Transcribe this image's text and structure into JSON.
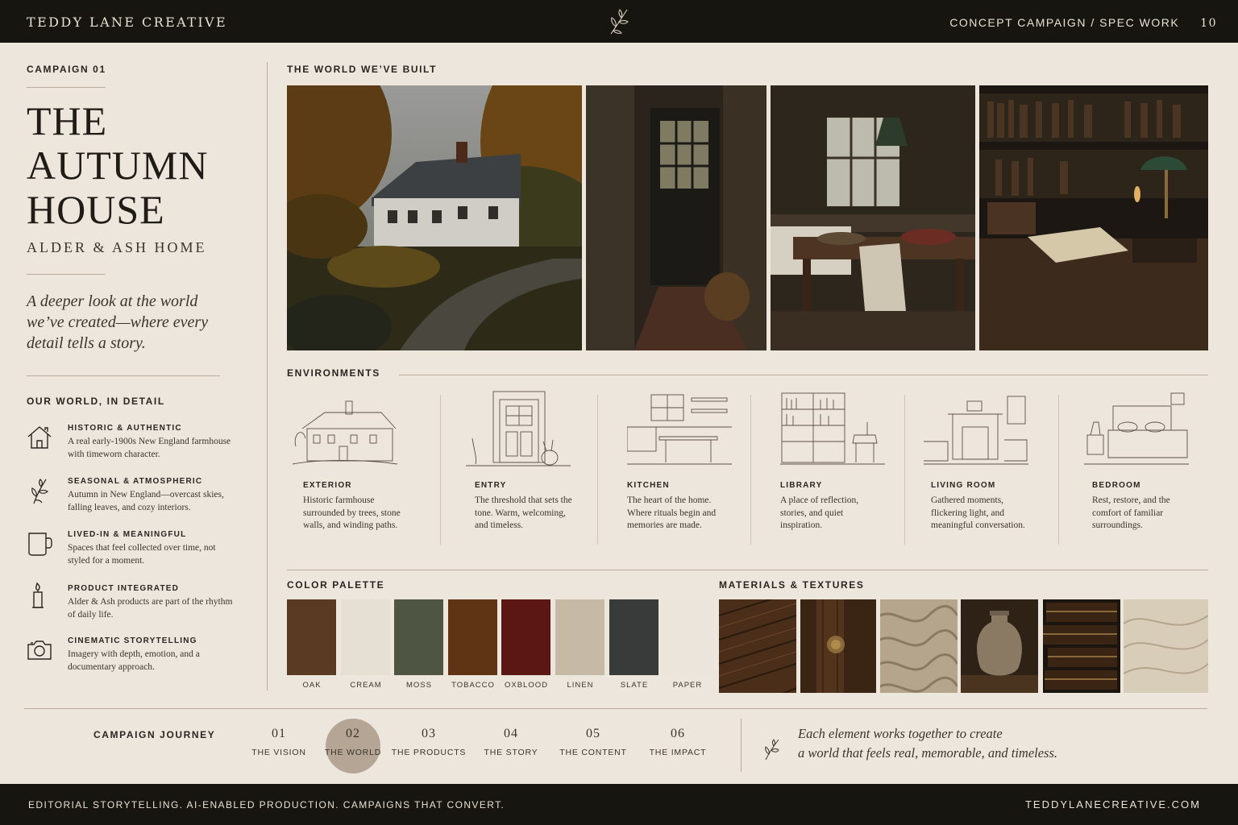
{
  "header": {
    "brand": "TEDDY LANE CREATIVE",
    "section": "CONCEPT CAMPAIGN / SPEC WORK",
    "page_number": "10"
  },
  "left": {
    "campaign_number": "CAMPAIGN 01",
    "title_lines": [
      "THE",
      "AUTUMN",
      "HOUSE"
    ],
    "subtitle": "ALDER & ASH HOME",
    "lede": "A deeper look at the world we’ve created—where every detail tells a story.",
    "world_heading": "OUR WORLD, IN DETAIL",
    "features": [
      {
        "icon": "house-icon",
        "title": "HISTORIC & AUTHENTIC",
        "desc": "A real early-1900s New England farmhouse with timeworn character."
      },
      {
        "icon": "leaf-sprig-icon",
        "title": "SEASONAL & ATMOSPHERIC",
        "desc": "Autumn in New England—overcast skies, falling leaves, and cozy interiors."
      },
      {
        "icon": "mug-icon",
        "title": "LIVED-IN & MEANINGFUL",
        "desc": "Spaces that feel collected over time, not styled for a moment."
      },
      {
        "icon": "candle-icon",
        "title": "PRODUCT INTEGRATED",
        "desc": "Alder & Ash products are part of the rhythm of daily life."
      },
      {
        "icon": "camera-icon",
        "title": "CINEMATIC STORYTELLING",
        "desc": "Imagery with depth, emotion, and a documentary approach."
      }
    ]
  },
  "world": {
    "heading": "THE WORLD WE’VE BUILT"
  },
  "environments": {
    "heading": "ENVIRONMENTS",
    "items": [
      {
        "title": "EXTERIOR",
        "desc": "Historic farmhouse surrounded by trees, stone walls, and winding paths."
      },
      {
        "title": "ENTRY",
        "desc": "The threshold that sets the tone. Warm, welcoming, and timeless."
      },
      {
        "title": "KITCHEN",
        "desc": "The heart of the home. Where rituals begin and memories are made."
      },
      {
        "title": "LIBRARY",
        "desc": "A place of reflection, stories, and quiet inspiration."
      },
      {
        "title": "LIVING ROOM",
        "desc": "Gathered moments, flickering light, and meaningful conversation."
      },
      {
        "title": "BEDROOM",
        "desc": "Rest, restore, and the comfort of familiar surroundings."
      }
    ]
  },
  "palette": {
    "heading": "COLOR PALETTE",
    "swatches": [
      {
        "name": "OAK",
        "color": "#5a3a22"
      },
      {
        "name": "CREAM",
        "color": "#e6dfd3"
      },
      {
        "name": "MOSS",
        "color": "#4e5542"
      },
      {
        "name": "TOBACCO",
        "color": "#5e3415"
      },
      {
        "name": "OXBLOOD",
        "color": "#5a1714"
      },
      {
        "name": "LINEN",
        "color": "#c6b9a6"
      },
      {
        "name": "SLATE",
        "color": "#393a3a"
      },
      {
        "name": "PAPER",
        "color": "#ebe5dc"
      }
    ]
  },
  "materials": {
    "heading": "MATERIALS & TEXTURES"
  },
  "journey": {
    "label": "CAMPAIGN JOURNEY",
    "steps": [
      {
        "num": "01",
        "label": "THE VISION"
      },
      {
        "num": "02",
        "label": "THE WORLD"
      },
      {
        "num": "03",
        "label": "THE PRODUCTS"
      },
      {
        "num": "04",
        "label": "THE STORY"
      },
      {
        "num": "05",
        "label": "THE CONTENT"
      },
      {
        "num": "06",
        "label": "THE IMPACT"
      }
    ],
    "active_step": "02",
    "quote_line1": "Each element works together to create",
    "quote_line2": "a world that feels real, memorable, and timeless."
  },
  "footer": {
    "tagline": "EDITORIAL STORYTELLING. AI-ENABLED PRODUCTION. CAMPAIGNS THAT CONVERT.",
    "url": "TEDDYLANECREATIVE.COM"
  }
}
